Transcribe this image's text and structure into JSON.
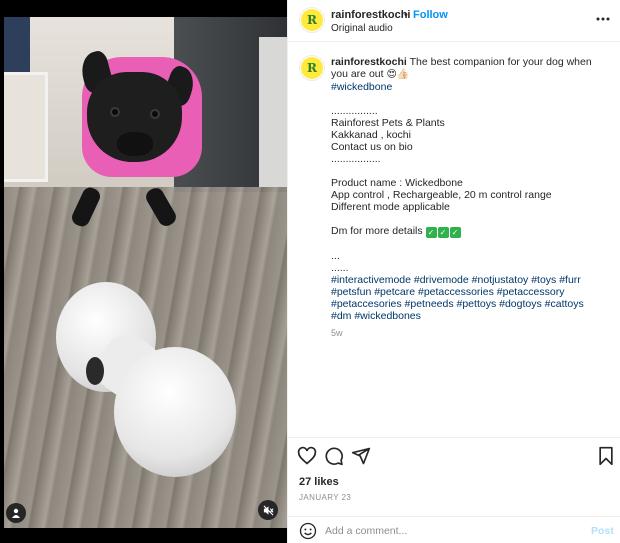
{
  "header": {
    "username": "rainforestkochi",
    "separator": "•",
    "follow_label": "Follow",
    "audio_label": "Original audio",
    "more_label": "•••"
  },
  "avatar": {
    "initial": "R"
  },
  "caption": {
    "username": "rainforestkochi",
    "intro": "The best companion for your dog when you are out",
    "intro_emoji": "😍👍🏻",
    "hashtag_first": "#wickedbone",
    "dots1": "................",
    "line_store": "Rainforest Pets & Plants",
    "line_location": "Kakkanad , kochi",
    "line_contact": "Contact us on bio",
    "dots2": ".................",
    "product_name": "Product name : Wickedbone",
    "product_features": "App control , Rechargeable, 20 m control range",
    "product_modes": "Different mode applicable",
    "dm_line": "Dm for more details",
    "dm_checks": [
      "✓",
      "✓",
      "✓"
    ],
    "ellipsis1": "...",
    "ellipsis2": "......",
    "hashtags": "#interactivemode #drivemode #notjustatoy #toys #furr #petsfun #petcare #petaccessories #petaccessory #petaccesories #petneeds #pettoys #dogtoys #cattoys #dm #wickedbones",
    "age": "5w"
  },
  "actions": {
    "likes": "27 likes",
    "date": "JANUARY 23"
  },
  "comment": {
    "placeholder": "Add a comment...",
    "post_label": "Post"
  },
  "icons": [
    "heart-icon",
    "comment-icon",
    "share-icon",
    "bookmark-icon",
    "emoji-icon",
    "user-tag-icon",
    "mute-icon"
  ],
  "colors": {
    "follow": "#0095f6",
    "hashtag": "#00376b",
    "post_disabled": "#b2dffc",
    "dog_hoodie": "#e85fb5",
    "avatar_bg": "#ffea3a"
  }
}
